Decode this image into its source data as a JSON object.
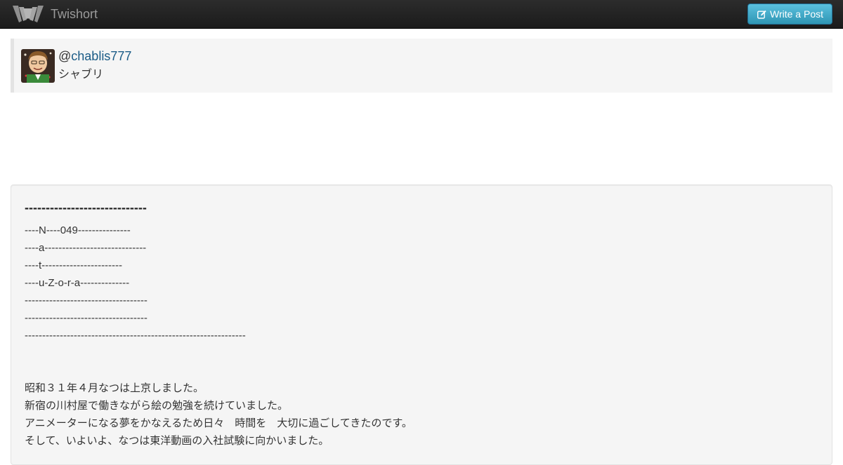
{
  "navbar": {
    "brand_name": "Twishort",
    "write_button_label": "Write a Post"
  },
  "colors": {
    "navbar_bg": "#222222",
    "button_accent": "#49afcd",
    "link": "#1a5b86",
    "panel_bg": "#f5f5f5"
  },
  "icons": {
    "logo": "twishort-logo",
    "write": "edit-icon"
  },
  "profile": {
    "at_symbol": "@",
    "handle": "chablis777",
    "display_name": "シャブリ"
  },
  "post": {
    "title": "-----------------------------",
    "lines": [
      "----N----049---------------",
      "----a-----------------------------",
      "----t-----------------------",
      "----u-Z-o-r-a--------------",
      "-----------------------------------",
      "-----------------------------------",
      "---------------------------------------------------------------",
      "",
      "",
      "昭和３１年４月なつは上京しました。",
      "新宿の川村屋で働きながら絵の勉強を続けていました。",
      "アニメーターになる夢をかなえるため日々　時間を　大切に過ごしてきたのです。",
      "そして、いよいよ、なつは東洋動画の入社試験に向かいました。"
    ]
  }
}
